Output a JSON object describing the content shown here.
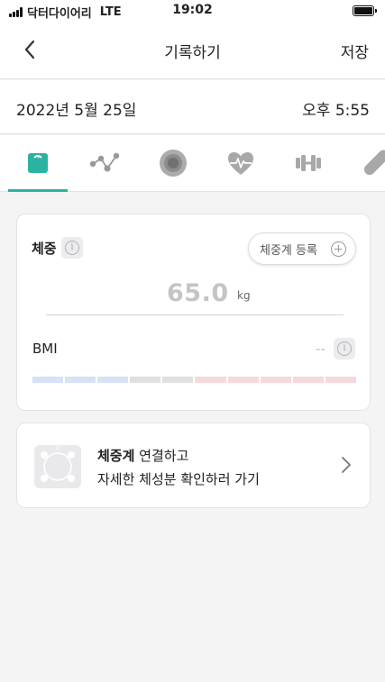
{
  "status_bar": {
    "carrier": "닥터다이어리",
    "network": "LTE",
    "time": "19:02"
  },
  "header": {
    "title": "기록하기",
    "save_label": "저장"
  },
  "record": {
    "date": "2022년 5월 25일",
    "time": "오후 5:55"
  },
  "tabs": {
    "items": [
      {
        "icon": "scale-icon",
        "selected": true
      },
      {
        "icon": "connected-dots-icon",
        "selected": false
      },
      {
        "icon": "circle-target-icon",
        "selected": false
      },
      {
        "icon": "heart-pulse-icon",
        "selected": false
      },
      {
        "icon": "dumbbell-icon",
        "selected": false
      },
      {
        "icon": "pill-icon",
        "selected": false
      }
    ],
    "accent_color": "#2bb3a1"
  },
  "weight_card": {
    "title": "체중",
    "register_label": "체중계 등록",
    "value": "65.0",
    "unit": "kg",
    "bmi_label": "BMI",
    "bmi_value": "--",
    "bmi_scale_colors": [
      "#d6e3f7",
      "#d6e3f7",
      "#d6e3f7",
      "#dfe0e2",
      "#dfe0e2",
      "#f6d9db",
      "#f6d9db",
      "#f6d9db",
      "#f6d9db",
      "#f6d9db"
    ]
  },
  "connect_card": {
    "line1_bold": "체중계",
    "line1_rest": " 연결하고",
    "line2": "자세한 체성분 확인하러 가기"
  }
}
